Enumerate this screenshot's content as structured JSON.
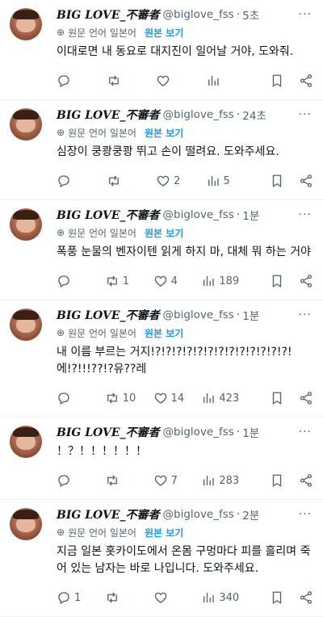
{
  "labels": {
    "translated_from": "원문 언어 일본어",
    "show_original": "원본 보기",
    "more": "···"
  },
  "tweets": [
    {
      "name": "BIG LOVE_不審者",
      "handle": "@biglove_fss",
      "time": "5초",
      "text": "이대로면 내 동요로 대지진이 일어날 거야, 도와줘.",
      "replies": "",
      "retweets": "",
      "likes": "",
      "views": ""
    },
    {
      "name": "BIG LOVE_不審者",
      "handle": "@biglove_fss",
      "time": "24초",
      "text": "심장이 쿵쾅쿵쾅 뛰고 손이 떨려요. 도와주세요.",
      "replies": "",
      "retweets": "",
      "likes": "2",
      "views": "5"
    },
    {
      "name": "BIG LOVE_不審者",
      "handle": "@biglove_fss",
      "time": "1분",
      "text": "폭풍 눈물의 벤자이텐 읽게 하지 마, 대체 뭐 하는 거야",
      "replies": "",
      "retweets": "1",
      "likes": "4",
      "views": "189"
    },
    {
      "name": "BIG LOVE_不審者",
      "handle": "@biglove_fss",
      "time": "1분",
      "text": "내 이름 부르는 거지!?!?!?!?!?!?!?!?!?!?!?!?!?! 에!?!!!??!?유??레",
      "replies": "",
      "retweets": "10",
      "likes": "14",
      "views": "423"
    },
    {
      "name": "BIG LOVE_不審者",
      "handle": "@biglove_fss",
      "time": "1분",
      "text": "！？！！！！！！",
      "replies": "",
      "retweets": "",
      "likes": "7",
      "views": "283"
    },
    {
      "name": "BIG LOVE_不審者",
      "handle": "@biglove_fss",
      "time": "2분",
      "text": "지금 일본 홋카이도에서 온몸 구멍마다 피를 흘리며 죽어 있는 남자는 바로 나입니다. 도와주세요.",
      "replies": "1",
      "retweets": "",
      "likes": "",
      "views": "340"
    }
  ]
}
